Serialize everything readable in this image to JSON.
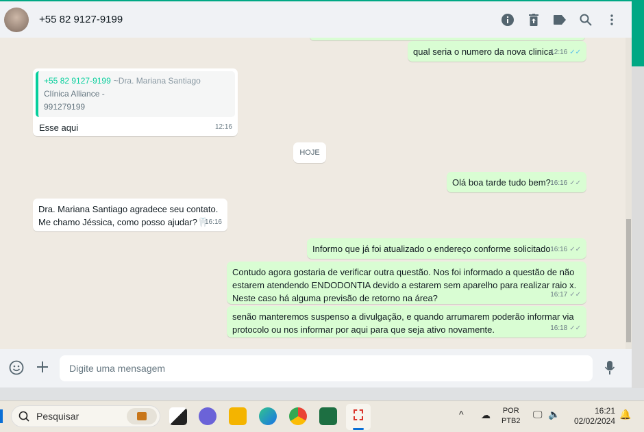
{
  "header": {
    "contact": "+55 82 9127-9199",
    "icons": [
      "info-icon",
      "delete-icon",
      "label-icon",
      "search-icon",
      "menu-icon"
    ]
  },
  "messages": [
    {
      "dir": "out",
      "text": "qual seria o numero da nova clinica",
      "time": "12:16"
    },
    {
      "dir": "in",
      "quote": {
        "name": "+55 82 9127-9199",
        "alias": "~Dra. Mariana Santiago",
        "line1": "Clínica Alliance -",
        "line2": "991279199"
      },
      "text": "Esse aqui",
      "time": "12:16"
    },
    {
      "dir": "out",
      "text": "Olá boa tarde tudo bem?",
      "time": "16:16"
    },
    {
      "dir": "in",
      "text1": "Dra. Mariana Santiago agradece seu contato.",
      "text2": "Me chamo Jéssica, como posso ajudar?🦷",
      "time": "16:16"
    },
    {
      "dir": "out",
      "text": "Informo que já foi atualizado o endereço conforme solicitado",
      "time": "16:16"
    },
    {
      "dir": "out",
      "text1": "Contudo agora gostaria de verificar outra questão. Nos foi informado a questão de não",
      "text2": "estarem atendendo ENDODONTIA devido a estarem sem aparelho para realizar raio x.",
      "text3": "Neste caso há alguma previsão de retorno na área?",
      "time": "16:17"
    },
    {
      "dir": "out",
      "text1": "senão manteremos suspenso a divulgação, e quando arrumarem poderão informar via",
      "text2": "protocolo ou nos informar por aqui para que seja ativo novamente.",
      "time": "16:18"
    }
  ],
  "day_divider": "HOJE",
  "input": {
    "placeholder": "Digite uma mensagem"
  },
  "taskbar": {
    "search": "Pesquisar",
    "lang1": "POR",
    "lang2": "PTB2",
    "time": "16:21",
    "date": "02/02/2024"
  }
}
